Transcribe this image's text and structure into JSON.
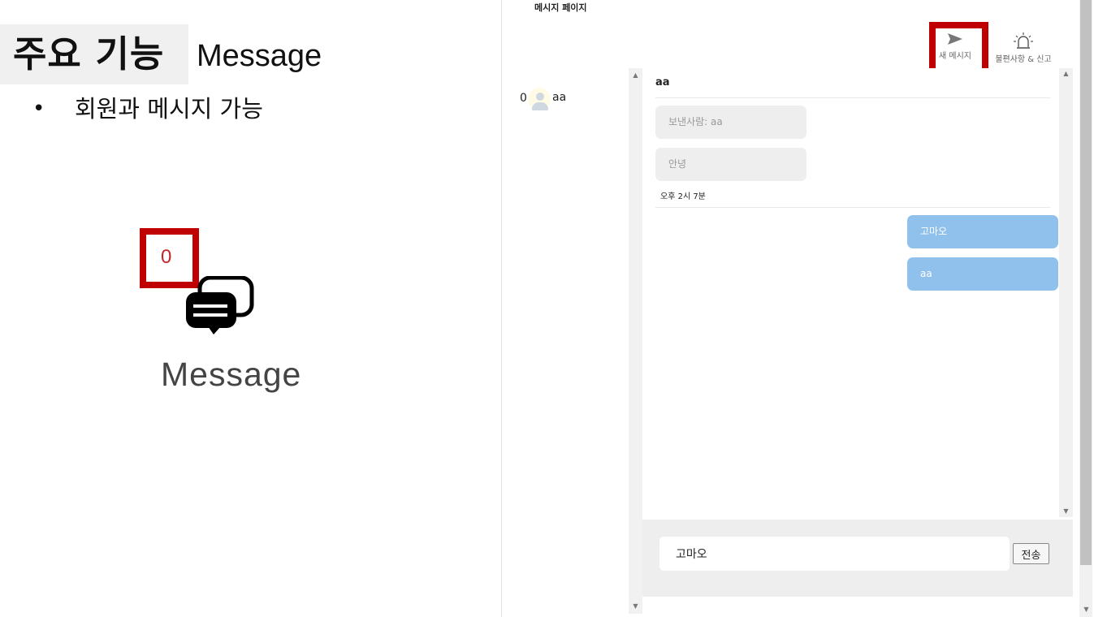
{
  "slide": {
    "title": "주요 기능",
    "subtitle": "Message",
    "bullet_marker": "•",
    "bullet": "회원과 메시지 가능",
    "message_count": "0",
    "message_label": "Message",
    "icon": "chat-bubbles-icon"
  },
  "app": {
    "page_heading": "메시지 페이지",
    "toolbar": {
      "new_message_label": "새 메시지",
      "new_message_icon": "send-icon",
      "report_label": "불편사항 & 신고",
      "report_icon": "alarm-siren-icon"
    },
    "conversations": [
      {
        "count": "0",
        "name": "aa",
        "icon": "avatar-icon"
      }
    ],
    "chat": {
      "header": "aa",
      "incoming": [
        "보낸사람: aa",
        "안녕"
      ],
      "timestamp": "오후 2시 7분",
      "outgoing": [
        "고마오",
        "aa"
      ],
      "input_value": "고마오",
      "send_label": "전송"
    }
  },
  "colors": {
    "highlight": "#c00000",
    "outgoing_bubble": "#90c0ec",
    "incoming_bubble": "#eeeeee"
  }
}
